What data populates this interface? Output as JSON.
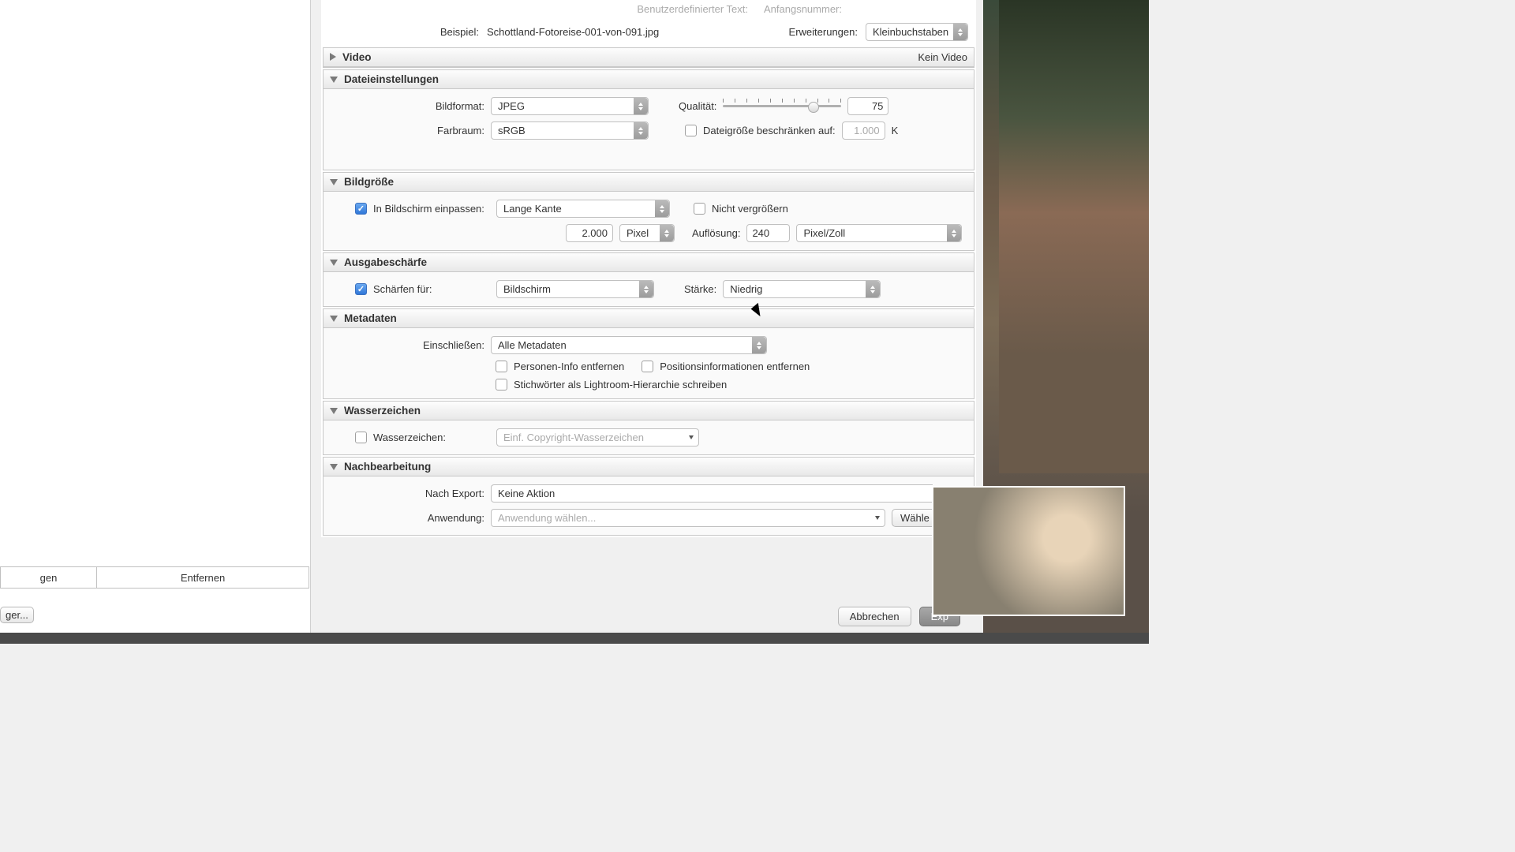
{
  "top": {
    "custom_text_label": "Benutzerdefinierter Text:",
    "start_num_label": "Anfangsnummer:",
    "example_label": "Beispiel:",
    "example_value": "Schottland-Fotoreise-001-von-091.jpg",
    "extensions_label": "Erweiterungen:",
    "extensions_value": "Kleinbuchstaben"
  },
  "video": {
    "title": "Video",
    "status": "Kein Video"
  },
  "file_settings": {
    "title": "Dateieinstellungen",
    "format_label": "Bildformat:",
    "format_value": "JPEG",
    "quality_label": "Qualität:",
    "quality_value": "75",
    "colorspace_label": "Farbraum:",
    "colorspace_value": "sRGB",
    "limit_label": "Dateigröße beschränken auf:",
    "limit_value": "1.000",
    "limit_unit": "K"
  },
  "image_size": {
    "title": "Bildgröße",
    "fit_label": "In Bildschirm einpassen:",
    "fit_value": "Lange Kante",
    "no_upscale": "Nicht vergrößern",
    "dimension": "2.000",
    "unit": "Pixel",
    "resolution_label": "Auflösung:",
    "resolution_value": "240",
    "resolution_unit": "Pixel/Zoll"
  },
  "sharpening": {
    "title": "Ausgabeschärfe",
    "sharpen_label": "Schärfen für:",
    "sharpen_value": "Bildschirm",
    "strength_label": "Stärke:",
    "strength_value": "Niedrig"
  },
  "metadata": {
    "title": "Metadaten",
    "include_label": "Einschließen:",
    "include_value": "Alle Metadaten",
    "remove_person": "Personen-Info entfernen",
    "remove_location": "Positionsinformationen entfernen",
    "keywords_hierarchy": "Stichwörter als Lightroom-Hierarchie schreiben"
  },
  "watermark": {
    "title": "Wasserzeichen",
    "label": "Wasserzeichen:",
    "value": "Einf. Copyright-Wasserzeichen"
  },
  "post": {
    "title": "Nachbearbeitung",
    "after_label": "Nach Export:",
    "after_value": "Keine Aktion",
    "app_label": "Anwendung:",
    "app_value": "Anwendung wählen...",
    "choose": "Wähle"
  },
  "buttons": {
    "cancel": "Abbrechen",
    "export": "Exp",
    "remove": "Entfernen",
    "add_suffix": "gen",
    "manager": "ger..."
  }
}
